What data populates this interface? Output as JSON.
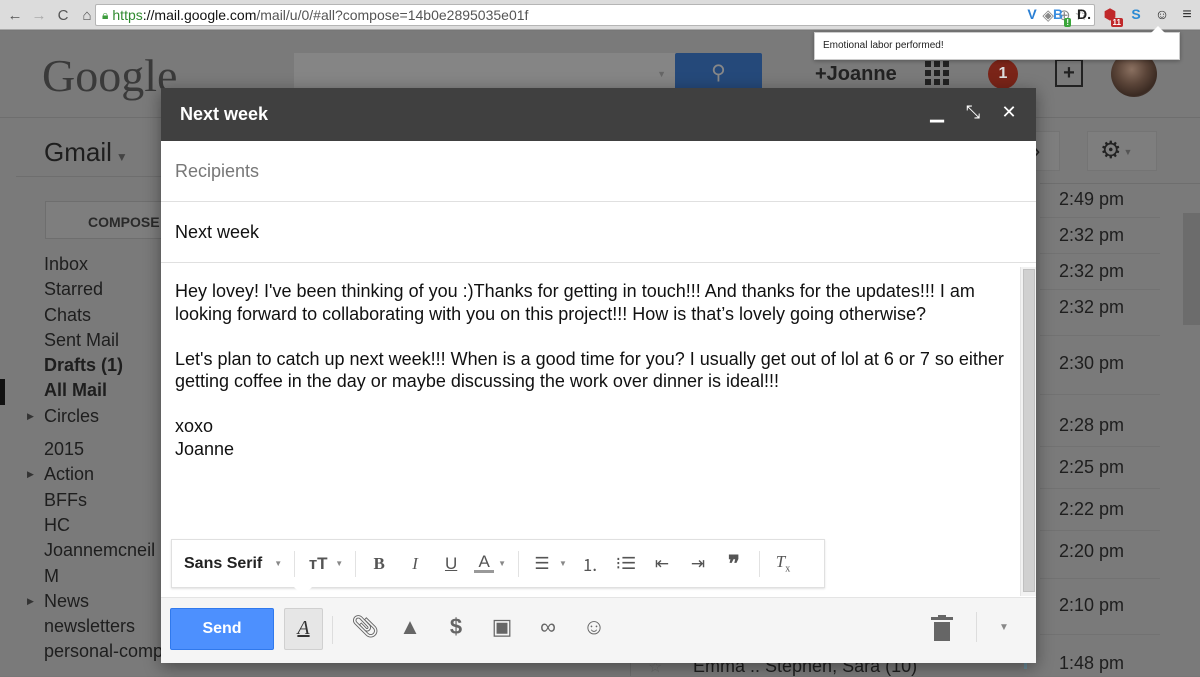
{
  "browser": {
    "url_scheme": "https",
    "url_host": "://mail.google.com",
    "url_path": "/mail/u/0/#all?compose=14b0e2895035e01f",
    "extension_popup": "Emotional labor performed!",
    "extensions": [
      {
        "name": "vivaldi-v",
        "glyph": "V",
        "color": "#2a7fd4"
      },
      {
        "name": "bitly-b",
        "glyph": "B",
        "color": "#3a8ee0",
        "badge": "!",
        "badge_color": "#3aa53a"
      },
      {
        "name": "d-dot",
        "glyph": "D.",
        "color": "#222"
      },
      {
        "name": "adblock",
        "glyph": "⬢",
        "color": "#c0282a",
        "badge": "11",
        "badge_color": "#c0282a"
      },
      {
        "name": "s-ext",
        "glyph": "S",
        "color": "#2a8ad4"
      },
      {
        "name": "smiley-ext",
        "glyph": "☺",
        "color": "#222"
      }
    ]
  },
  "gmail": {
    "logo": "Google",
    "user_label": "+Joanne",
    "notification_count": "1",
    "app_label": "Gmail",
    "compose_label": "COMPOSE",
    "nav": [
      {
        "label": "Inbox",
        "bold": false,
        "expander": false
      },
      {
        "label": "Starred",
        "bold": false,
        "expander": false
      },
      {
        "label": "Chats",
        "bold": false,
        "expander": false
      },
      {
        "label": "Sent Mail",
        "bold": false,
        "expander": false
      },
      {
        "label": "Drafts (1)",
        "bold": true,
        "expander": false
      },
      {
        "label": "All Mail",
        "bold": true,
        "expander": false
      },
      {
        "label": "Circles",
        "bold": false,
        "expander": true
      },
      {
        "label": "2015",
        "bold": false,
        "expander": false
      },
      {
        "label": "Action",
        "bold": false,
        "expander": true
      },
      {
        "label": "BFFs",
        "bold": false,
        "expander": false
      },
      {
        "label": "HC",
        "bold": false,
        "expander": false
      },
      {
        "label": "Joannemcneil",
        "bold": false,
        "expander": false
      },
      {
        "label": "M",
        "bold": false,
        "expander": false
      },
      {
        "label": "News",
        "bold": false,
        "expander": true
      },
      {
        "label": "newsletters",
        "bold": false,
        "expander": false
      },
      {
        "label": "personal-comp",
        "bold": false,
        "expander": false
      }
    ],
    "times": [
      "2:49 pm",
      "2:32 pm",
      "2:32 pm",
      "2:32 pm",
      "2:30 pm",
      "2:28 pm",
      "2:25 pm",
      "2:22 pm",
      "2:20 pm",
      "2:10 pm",
      "1:48 pm"
    ],
    "last_row_sender": "Emma .. Stephen, Sara (10)"
  },
  "compose": {
    "title": "Next week",
    "recipients_placeholder": "Recipients",
    "subject": "Next week",
    "body": [
      "Hey lovey! I've been thinking of you :)Thanks for getting in touch!!! And thanks for the updates!!! I am looking forward to collaborating with you on this project!!! How is that’s lovely going otherwise?",
      "Let's plan to catch up next week!!! When is a good time for you? I usually get out of lol at 6 or 7 so either getting coffee in the day or maybe discussing the work over dinner is ideal!!!",
      "xoxo\nJoanne"
    ],
    "font_selector": "Sans Serif",
    "send_label": "Send",
    "send_color": "#4d90fe"
  }
}
